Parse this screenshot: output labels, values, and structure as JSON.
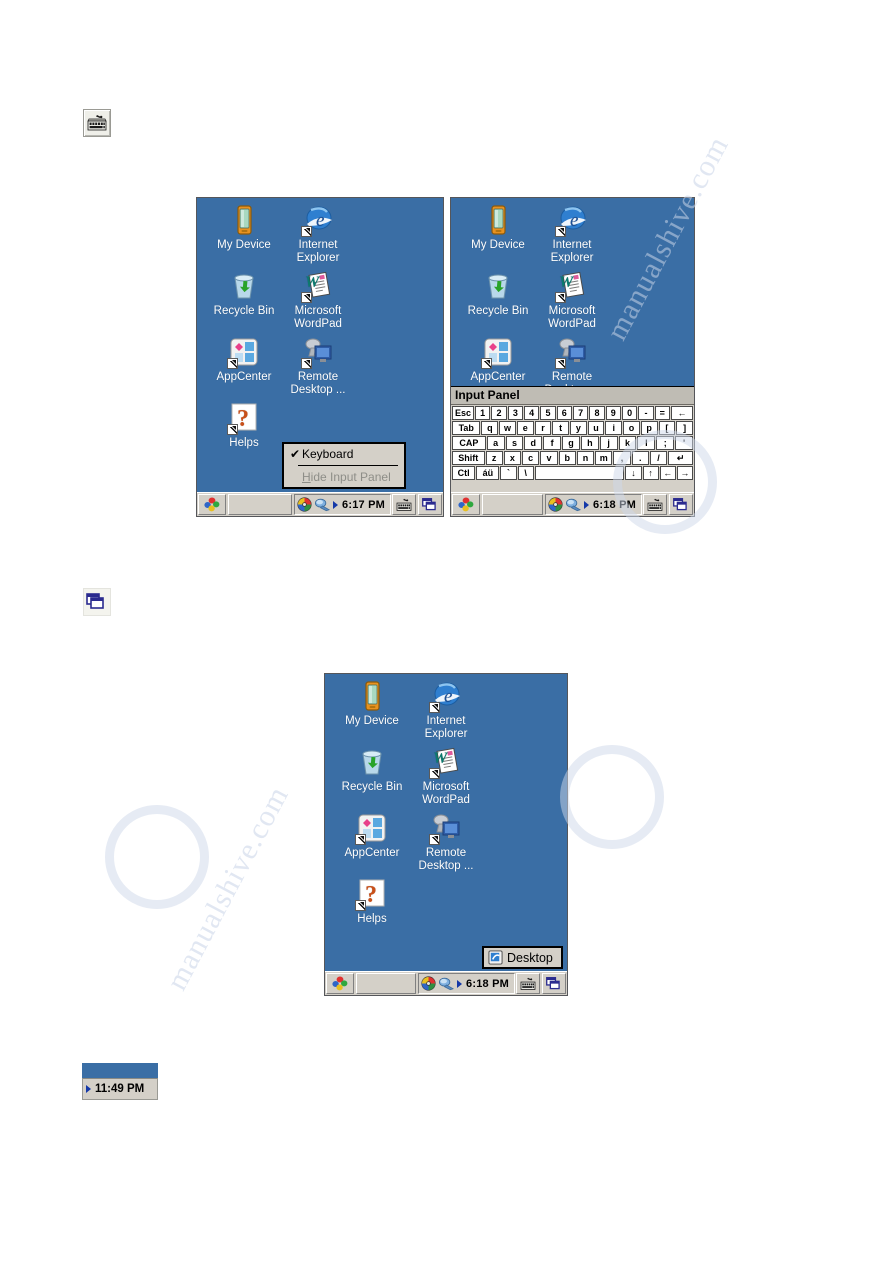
{
  "page": {
    "background": "#ffffff",
    "desktop_color": "#3a6ea5",
    "taskbar_color": "#d4d0c8"
  },
  "standalone_icons": [
    {
      "name": "keyboard-input-panel-icon",
      "glyph": "keyboard"
    },
    {
      "name": "cascade-windows-icon",
      "glyph": "cascade"
    }
  ],
  "desktop_icons": [
    {
      "id": "my-device",
      "label": "My Device",
      "shortcut": false
    },
    {
      "id": "internet-explorer",
      "label": "Internet\nExplorer",
      "line1": "Internet",
      "line2": "Explorer",
      "shortcut": true
    },
    {
      "id": "recycle-bin",
      "label": "Recycle Bin",
      "shortcut": false
    },
    {
      "id": "microsoft-wordpad",
      "label": "Microsoft\nWordPad",
      "line1": "Microsoft",
      "line2": "WordPad",
      "shortcut": true
    },
    {
      "id": "appcenter",
      "label": "AppCenter",
      "shortcut": true
    },
    {
      "id": "remote-desktop",
      "label": "Remote\nDesktop ...",
      "line1": "Remote",
      "line2": "Desktop ...",
      "shortcut": true
    },
    {
      "id": "helps",
      "label": "Helps",
      "shortcut": true
    }
  ],
  "screenshot_1": {
    "time": "6:17 PM",
    "context_menu": {
      "items": [
        {
          "label": "Keyboard",
          "checked": true,
          "disabled": false,
          "check_mark": "✔"
        },
        {
          "label": "Hide Input Panel",
          "checked": false,
          "disabled": true,
          "accel_char": "H",
          "rest": "ide Input Panel"
        }
      ]
    }
  },
  "screenshot_2": {
    "time": "6:18 PM",
    "input_panel": {
      "title": "Input Panel",
      "rows": [
        [
          {
            "k": "Esc",
            "w": "w15"
          },
          {
            "k": "1"
          },
          {
            "k": "2"
          },
          {
            "k": "3"
          },
          {
            "k": "4"
          },
          {
            "k": "5"
          },
          {
            "k": "6"
          },
          {
            "k": "7"
          },
          {
            "k": "8"
          },
          {
            "k": "9"
          },
          {
            "k": "0"
          },
          {
            "k": "-"
          },
          {
            "k": "="
          },
          {
            "k": "←",
            "w": "w15"
          }
        ],
        [
          {
            "k": "Tab",
            "w": "w18"
          },
          {
            "k": "q"
          },
          {
            "k": "w"
          },
          {
            "k": "e"
          },
          {
            "k": "r"
          },
          {
            "k": "t"
          },
          {
            "k": "y"
          },
          {
            "k": "u"
          },
          {
            "k": "i"
          },
          {
            "k": "o"
          },
          {
            "k": "p"
          },
          {
            "k": "["
          },
          {
            "k": "]"
          }
        ],
        [
          {
            "k": "CAP",
            "w": "w20"
          },
          {
            "k": "a"
          },
          {
            "k": "s"
          },
          {
            "k": "d"
          },
          {
            "k": "f"
          },
          {
            "k": "g"
          },
          {
            "k": "h"
          },
          {
            "k": "j"
          },
          {
            "k": "k"
          },
          {
            "k": "l"
          },
          {
            "k": ";"
          },
          {
            "k": "'"
          }
        ],
        [
          {
            "k": "Shift",
            "w": "w20"
          },
          {
            "k": "z"
          },
          {
            "k": "x"
          },
          {
            "k": "c"
          },
          {
            "k": "v"
          },
          {
            "k": "b"
          },
          {
            "k": "n"
          },
          {
            "k": "m"
          },
          {
            "k": ","
          },
          {
            "k": "."
          },
          {
            "k": "/"
          },
          {
            "k": "↵",
            "w": "w15"
          }
        ],
        [
          {
            "k": "Ctl",
            "w": "w15"
          },
          {
            "k": "áü",
            "w": "w15"
          },
          {
            "k": "`"
          },
          {
            "k": "\\"
          },
          {
            "k": "",
            "w": "space"
          },
          {
            "k": "↓"
          },
          {
            "k": "↑"
          },
          {
            "k": "←"
          },
          {
            "k": "→"
          }
        ]
      ]
    }
  },
  "screenshot_3": {
    "time": "6:18 PM",
    "desktop_button": {
      "label": "Desktop",
      "icon": "desktop-icon"
    }
  },
  "clock_sample": {
    "time": "11:49 PM",
    "arrow": "▶"
  },
  "watermark": {
    "text_1": "manualshive.com",
    "text_2": "manualshive.com"
  }
}
